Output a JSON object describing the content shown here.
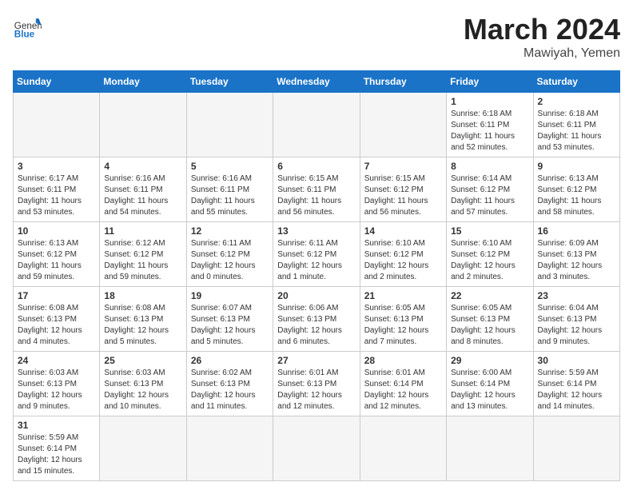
{
  "header": {
    "logo_general": "General",
    "logo_blue": "Blue",
    "month_year": "March 2024",
    "location": "Mawiyah, Yemen"
  },
  "weekdays": [
    "Sunday",
    "Monday",
    "Tuesday",
    "Wednesday",
    "Thursday",
    "Friday",
    "Saturday"
  ],
  "weeks": [
    [
      {
        "day": "",
        "info": ""
      },
      {
        "day": "",
        "info": ""
      },
      {
        "day": "",
        "info": ""
      },
      {
        "day": "",
        "info": ""
      },
      {
        "day": "",
        "info": ""
      },
      {
        "day": "1",
        "info": "Sunrise: 6:18 AM\nSunset: 6:11 PM\nDaylight: 11 hours\nand 52 minutes."
      },
      {
        "day": "2",
        "info": "Sunrise: 6:18 AM\nSunset: 6:11 PM\nDaylight: 11 hours\nand 53 minutes."
      }
    ],
    [
      {
        "day": "3",
        "info": "Sunrise: 6:17 AM\nSunset: 6:11 PM\nDaylight: 11 hours\nand 53 minutes."
      },
      {
        "day": "4",
        "info": "Sunrise: 6:16 AM\nSunset: 6:11 PM\nDaylight: 11 hours\nand 54 minutes."
      },
      {
        "day": "5",
        "info": "Sunrise: 6:16 AM\nSunset: 6:11 PM\nDaylight: 11 hours\nand 55 minutes."
      },
      {
        "day": "6",
        "info": "Sunrise: 6:15 AM\nSunset: 6:11 PM\nDaylight: 11 hours\nand 56 minutes."
      },
      {
        "day": "7",
        "info": "Sunrise: 6:15 AM\nSunset: 6:12 PM\nDaylight: 11 hours\nand 56 minutes."
      },
      {
        "day": "8",
        "info": "Sunrise: 6:14 AM\nSunset: 6:12 PM\nDaylight: 11 hours\nand 57 minutes."
      },
      {
        "day": "9",
        "info": "Sunrise: 6:13 AM\nSunset: 6:12 PM\nDaylight: 11 hours\nand 58 minutes."
      }
    ],
    [
      {
        "day": "10",
        "info": "Sunrise: 6:13 AM\nSunset: 6:12 PM\nDaylight: 11 hours\nand 59 minutes."
      },
      {
        "day": "11",
        "info": "Sunrise: 6:12 AM\nSunset: 6:12 PM\nDaylight: 11 hours\nand 59 minutes."
      },
      {
        "day": "12",
        "info": "Sunrise: 6:11 AM\nSunset: 6:12 PM\nDaylight: 12 hours\nand 0 minutes."
      },
      {
        "day": "13",
        "info": "Sunrise: 6:11 AM\nSunset: 6:12 PM\nDaylight: 12 hours\nand 1 minute."
      },
      {
        "day": "14",
        "info": "Sunrise: 6:10 AM\nSunset: 6:12 PM\nDaylight: 12 hours\nand 2 minutes."
      },
      {
        "day": "15",
        "info": "Sunrise: 6:10 AM\nSunset: 6:12 PM\nDaylight: 12 hours\nand 2 minutes."
      },
      {
        "day": "16",
        "info": "Sunrise: 6:09 AM\nSunset: 6:13 PM\nDaylight: 12 hours\nand 3 minutes."
      }
    ],
    [
      {
        "day": "17",
        "info": "Sunrise: 6:08 AM\nSunset: 6:13 PM\nDaylight: 12 hours\nand 4 minutes."
      },
      {
        "day": "18",
        "info": "Sunrise: 6:08 AM\nSunset: 6:13 PM\nDaylight: 12 hours\nand 5 minutes."
      },
      {
        "day": "19",
        "info": "Sunrise: 6:07 AM\nSunset: 6:13 PM\nDaylight: 12 hours\nand 5 minutes."
      },
      {
        "day": "20",
        "info": "Sunrise: 6:06 AM\nSunset: 6:13 PM\nDaylight: 12 hours\nand 6 minutes."
      },
      {
        "day": "21",
        "info": "Sunrise: 6:05 AM\nSunset: 6:13 PM\nDaylight: 12 hours\nand 7 minutes."
      },
      {
        "day": "22",
        "info": "Sunrise: 6:05 AM\nSunset: 6:13 PM\nDaylight: 12 hours\nand 8 minutes."
      },
      {
        "day": "23",
        "info": "Sunrise: 6:04 AM\nSunset: 6:13 PM\nDaylight: 12 hours\nand 9 minutes."
      }
    ],
    [
      {
        "day": "24",
        "info": "Sunrise: 6:03 AM\nSunset: 6:13 PM\nDaylight: 12 hours\nand 9 minutes."
      },
      {
        "day": "25",
        "info": "Sunrise: 6:03 AM\nSunset: 6:13 PM\nDaylight: 12 hours\nand 10 minutes."
      },
      {
        "day": "26",
        "info": "Sunrise: 6:02 AM\nSunset: 6:13 PM\nDaylight: 12 hours\nand 11 minutes."
      },
      {
        "day": "27",
        "info": "Sunrise: 6:01 AM\nSunset: 6:13 PM\nDaylight: 12 hours\nand 12 minutes."
      },
      {
        "day": "28",
        "info": "Sunrise: 6:01 AM\nSunset: 6:14 PM\nDaylight: 12 hours\nand 12 minutes."
      },
      {
        "day": "29",
        "info": "Sunrise: 6:00 AM\nSunset: 6:14 PM\nDaylight: 12 hours\nand 13 minutes."
      },
      {
        "day": "30",
        "info": "Sunrise: 5:59 AM\nSunset: 6:14 PM\nDaylight: 12 hours\nand 14 minutes."
      }
    ],
    [
      {
        "day": "31",
        "info": "Sunrise: 5:59 AM\nSunset: 6:14 PM\nDaylight: 12 hours\nand 15 minutes."
      },
      {
        "day": "",
        "info": ""
      },
      {
        "day": "",
        "info": ""
      },
      {
        "day": "",
        "info": ""
      },
      {
        "day": "",
        "info": ""
      },
      {
        "day": "",
        "info": ""
      },
      {
        "day": "",
        "info": ""
      }
    ]
  ]
}
